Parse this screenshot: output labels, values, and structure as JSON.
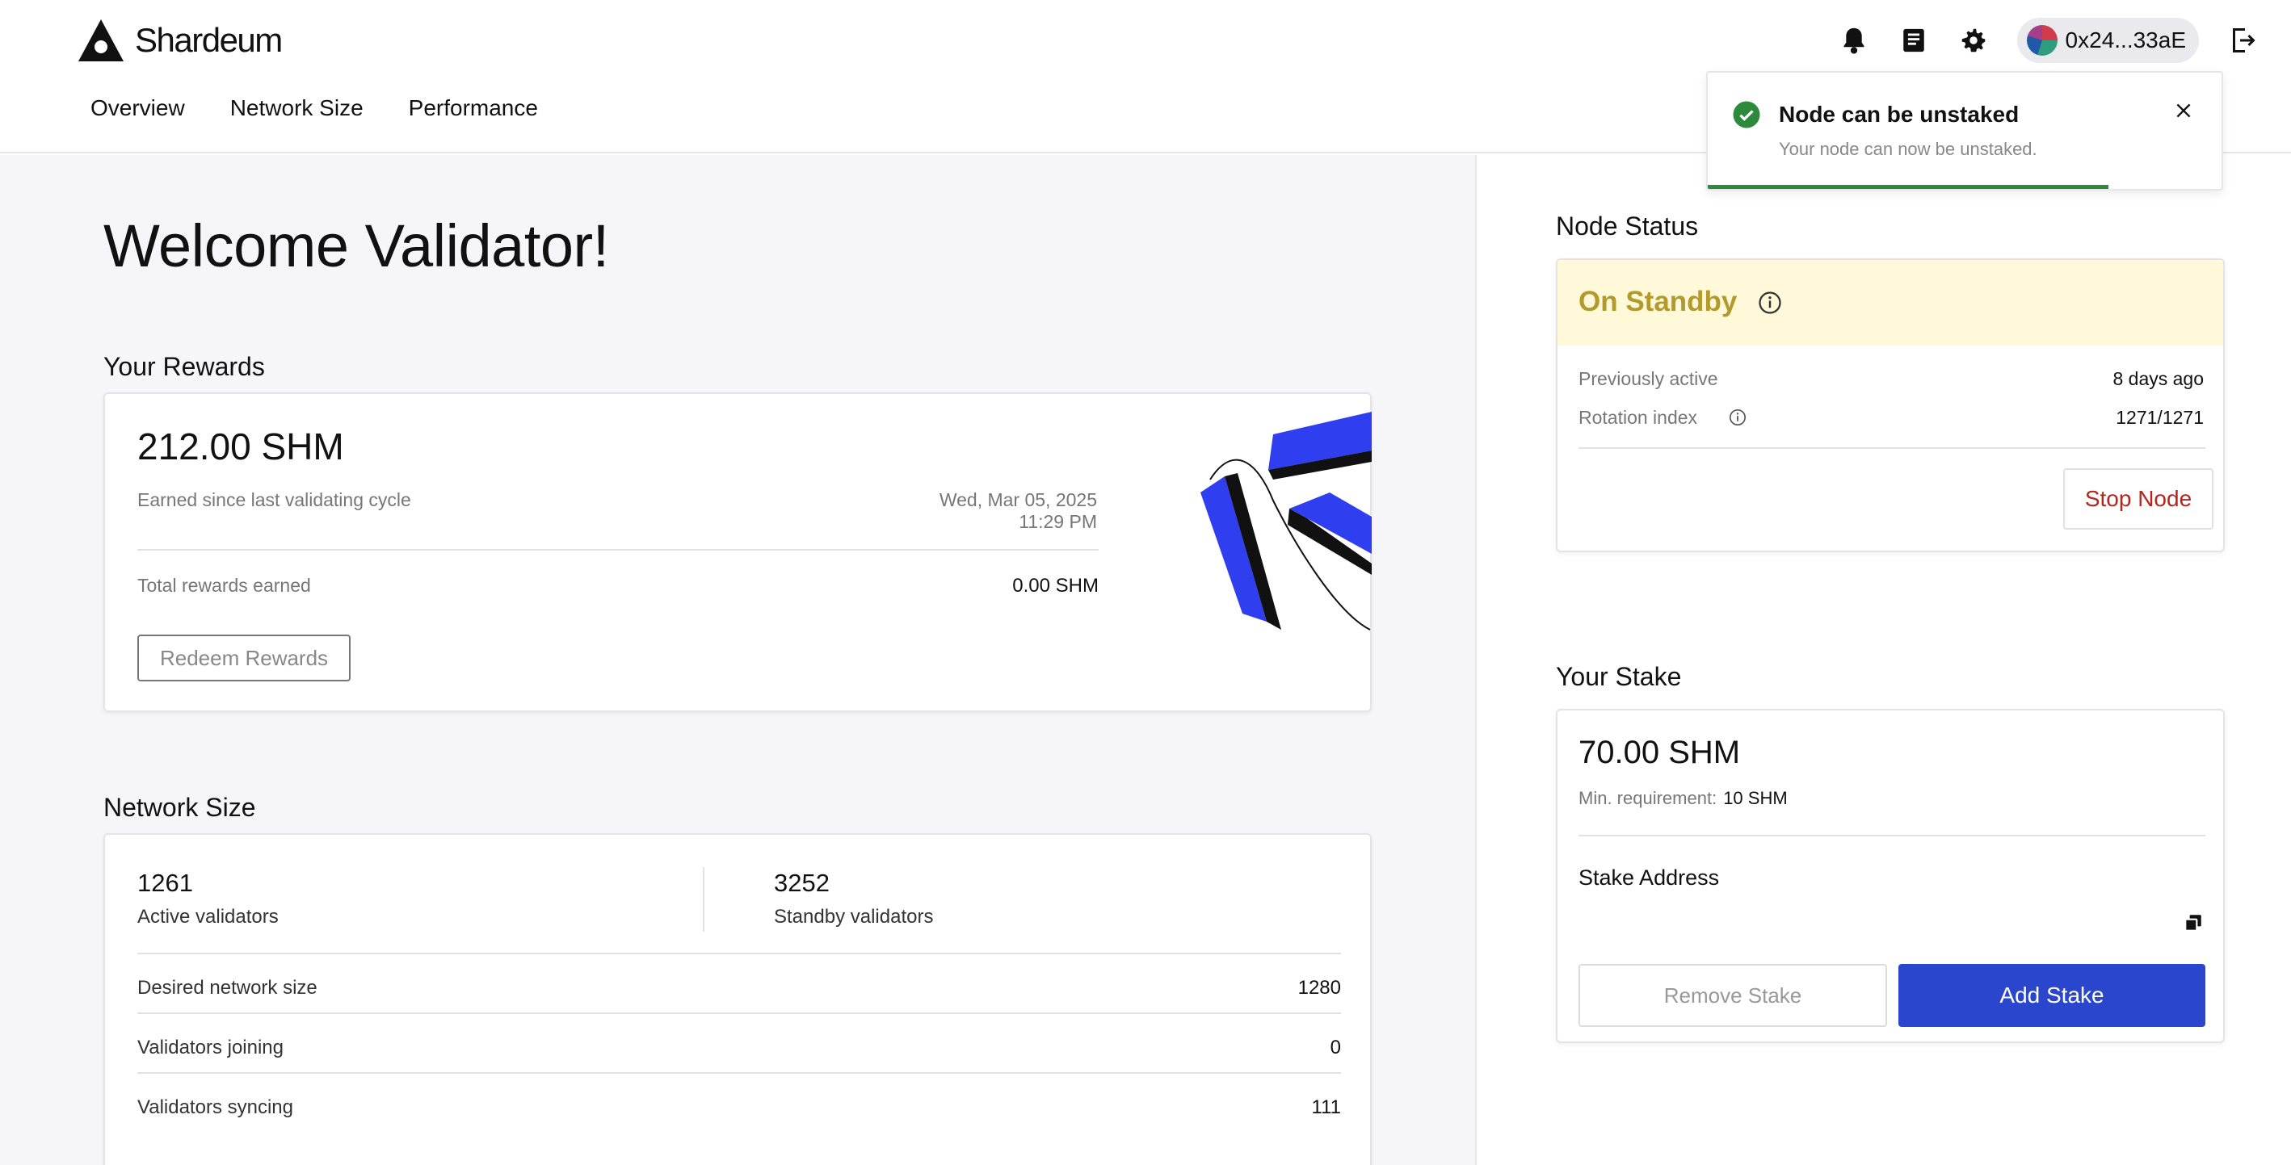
{
  "header": {
    "logo_text": "Shardeum",
    "nav": [
      "Overview",
      "Network Size",
      "Performance"
    ],
    "wallet_address": "0x24...33aE",
    "icons": [
      "bell-icon",
      "book-icon",
      "gear-icon",
      "logout-icon"
    ]
  },
  "toast": {
    "title": "Node can be unstaked",
    "message": "Your node can now be unstaked.",
    "progress": 0.78
  },
  "welcome": "Welcome Validator!",
  "rewards": {
    "section_title": "Your Rewards",
    "amount": "212.00 SHM",
    "earned_label": "Earned since last validating cycle",
    "timestamp": "Wed, Mar 05, 2025 11:29 PM",
    "total_label": "Total rewards earned",
    "total_value": "0.00 SHM",
    "redeem_button": "Redeem Rewards"
  },
  "network": {
    "section_title": "Network Size",
    "active_count": "1261",
    "active_label": "Active validators",
    "standby_count": "3252",
    "standby_label": "Standby validators",
    "rows": [
      {
        "label": "Desired network size",
        "value": "1280"
      },
      {
        "label": "Validators joining",
        "value": "0"
      },
      {
        "label": "Validators syncing",
        "value": "111"
      }
    ]
  },
  "node_status": {
    "section_title": "Node Status",
    "status": "On Standby",
    "status_bg": "#fff9d9",
    "status_color": "#b39a2c",
    "prev_active_label": "Previously active",
    "prev_active_value": "8 days ago",
    "rotation_label": "Rotation index",
    "rotation_value": "1271/1271",
    "stop_button": "Stop Node"
  },
  "stake": {
    "section_title": "Your Stake",
    "amount": "70.00 SHM",
    "min_label": "Min. requirement:",
    "min_value": "10 SHM",
    "address_label": "Stake Address",
    "remove_button": "Remove Stake",
    "add_button": "Add Stake",
    "accent": "#2a46cc"
  }
}
